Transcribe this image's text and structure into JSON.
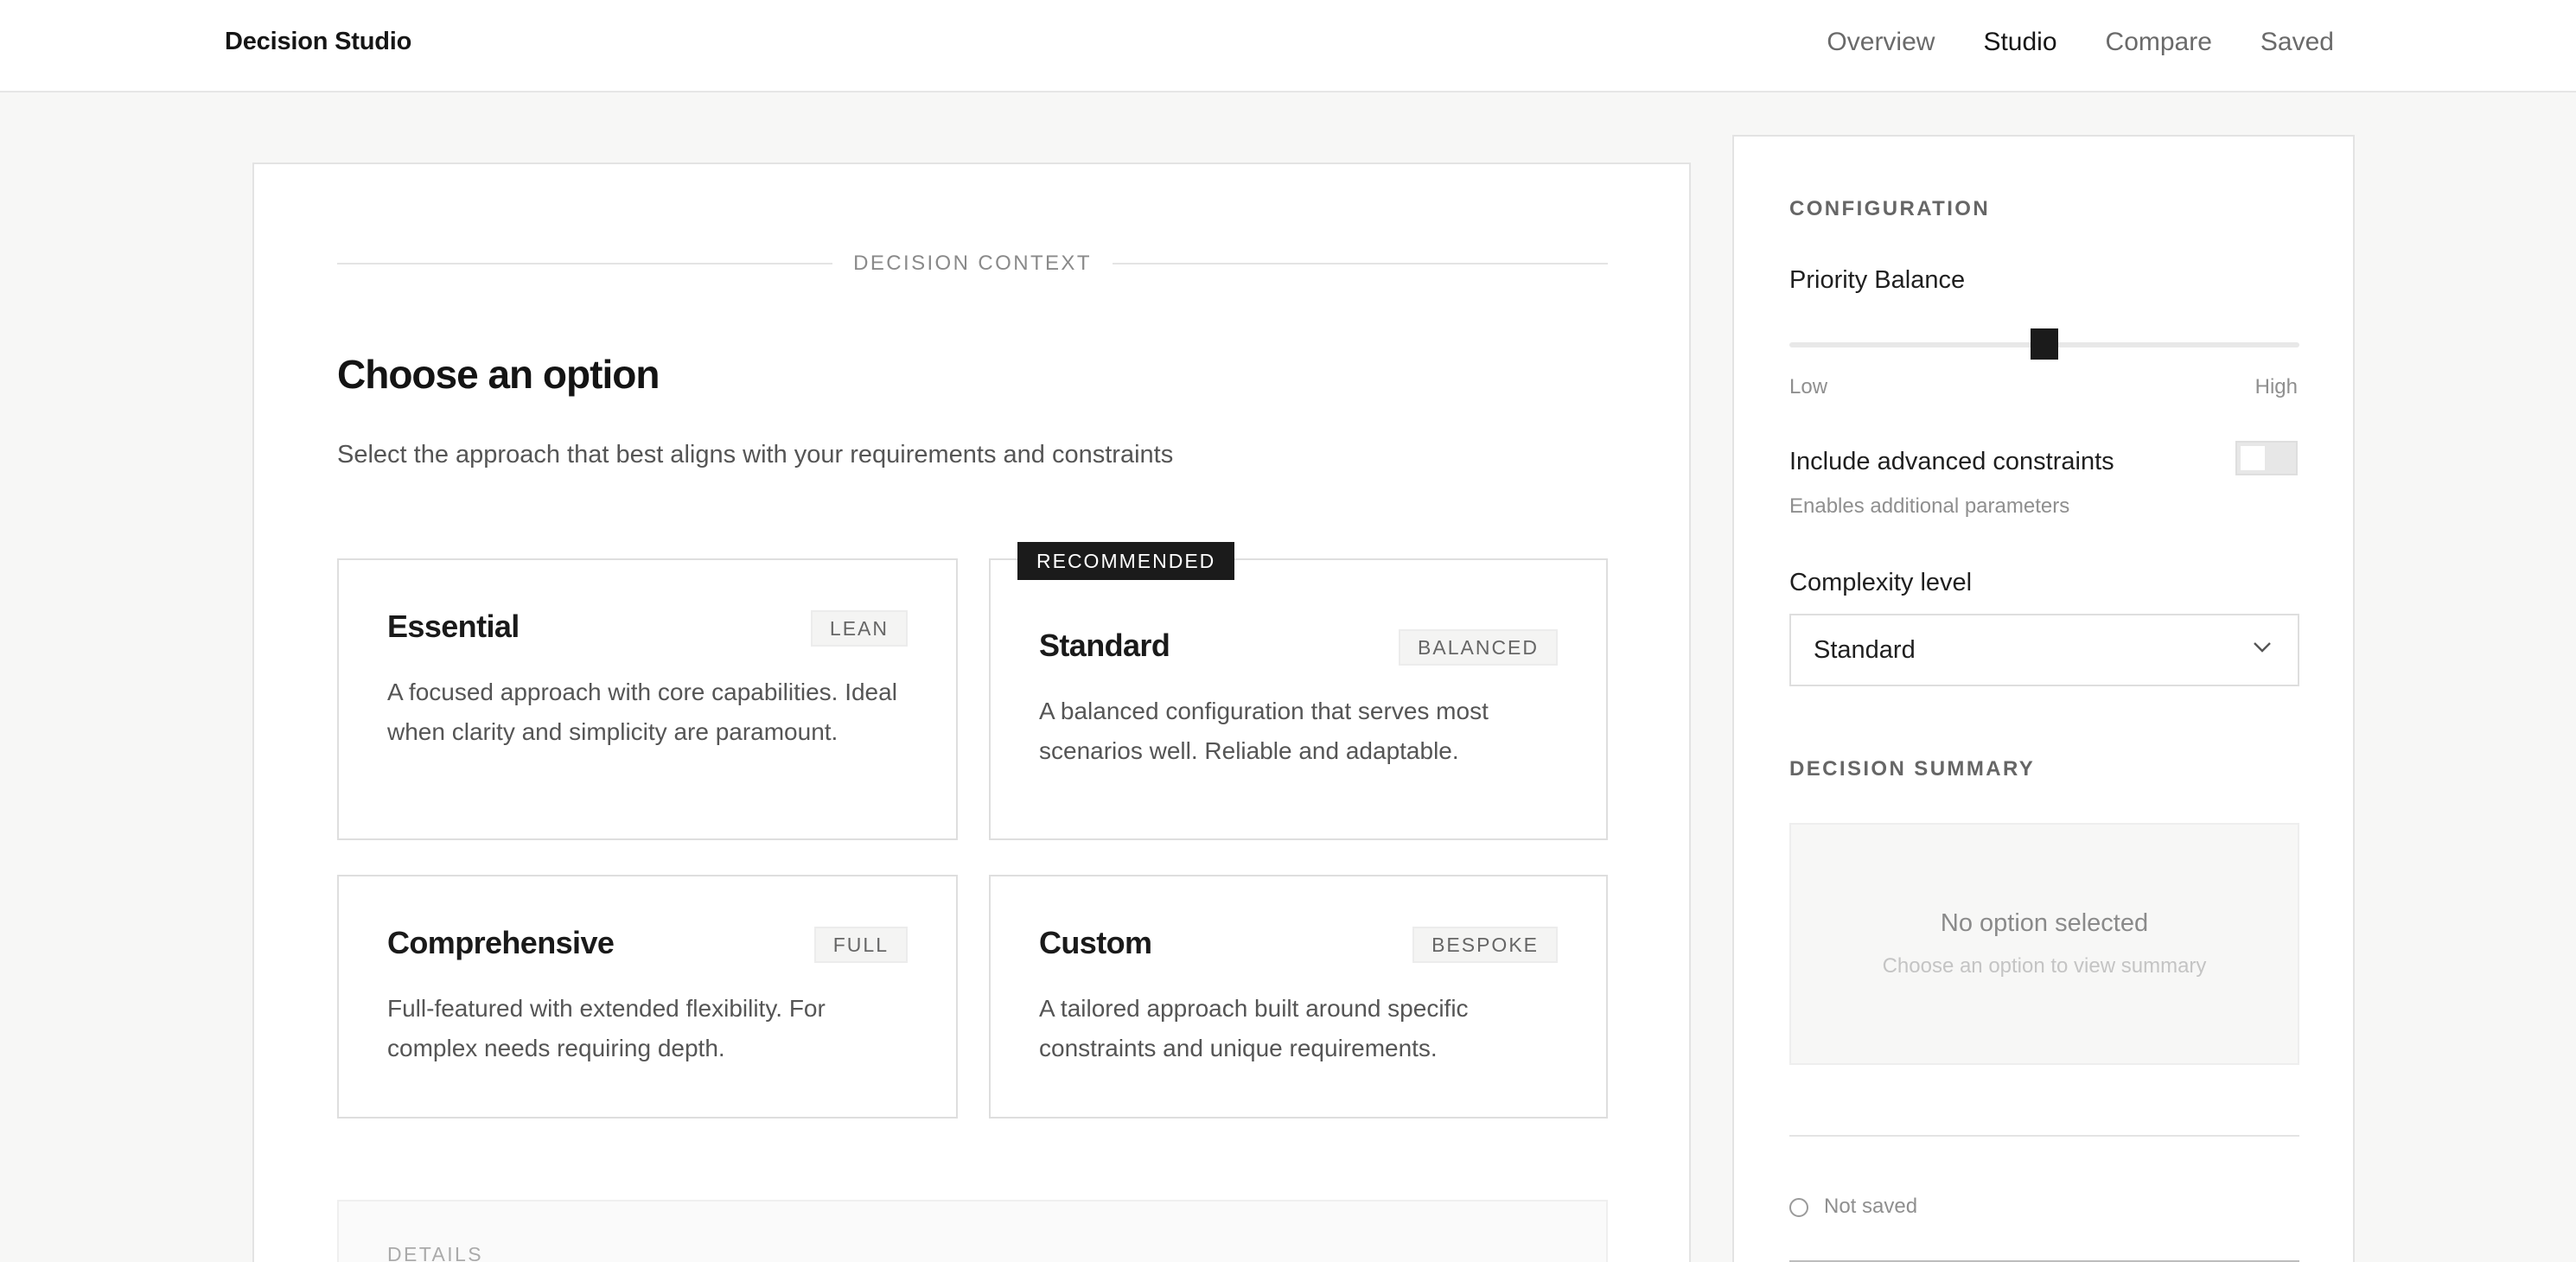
{
  "brand": "Decision Studio",
  "nav": {
    "items": [
      {
        "label": "Overview",
        "active": false
      },
      {
        "label": "Studio",
        "active": true
      },
      {
        "label": "Compare",
        "active": false
      },
      {
        "label": "Saved",
        "active": false
      }
    ]
  },
  "main": {
    "section_label": "DECISION CONTEXT",
    "title": "Choose an option",
    "subtitle": "Select the approach that best aligns with your requirements and constraints",
    "recommended_badge": "RECOMMENDED",
    "options": [
      {
        "name": "Essential",
        "tag": "LEAN",
        "description": "A focused approach with core capabilities. Ideal when clarity and simplicity are paramount."
      },
      {
        "name": "Standard",
        "tag": "BALANCED",
        "description": "A balanced configuration that serves most scenarios well. Reliable and adaptable."
      },
      {
        "name": "Comprehensive",
        "tag": "FULL",
        "description": "Full-featured with extended flexibility. For complex needs requiring depth."
      },
      {
        "name": "Custom",
        "tag": "BESPOKE",
        "description": "A tailored approach built around specific constraints and unique requirements."
      }
    ],
    "details_label": "DETAILS"
  },
  "side": {
    "config_header": "CONFIGURATION",
    "priority_label": "Priority Balance",
    "priority_value": 0.5,
    "slider_min": "Low",
    "slider_max": "High",
    "advanced_label": "Include advanced constraints",
    "advanced_enabled": false,
    "advanced_hint": "Enables additional parameters",
    "complexity_label": "Complexity level",
    "complexity_value": "Standard",
    "summary_header": "DECISION SUMMARY",
    "summary_empty_title": "No option selected",
    "summary_empty_hint": "Choose an option to view summary",
    "status_text": "Not saved"
  },
  "colors": {
    "accent": "#1b1b1b",
    "background": "#f7f7f6",
    "card": "#ffffff",
    "border": "#dedede"
  }
}
